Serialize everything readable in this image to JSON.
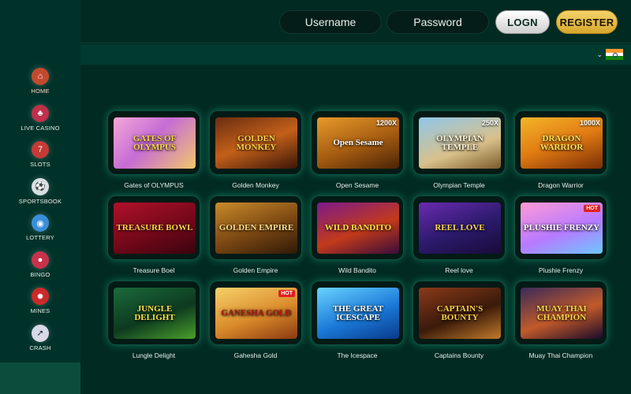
{
  "header": {
    "username_placeholder": "Username",
    "password_placeholder": "Password",
    "login_label": "LOGN",
    "register_label": "REGISTER"
  },
  "language": {
    "icon": "india-flag-icon"
  },
  "sidebar": {
    "items": [
      {
        "label": "HOME",
        "icon": "home-icon",
        "color": "#c24a2e"
      },
      {
        "label": "LIVE CASINO",
        "icon": "live-casino-icon",
        "color": "#c0304a"
      },
      {
        "label": "SLOTS",
        "icon": "slots-icon",
        "color": "#c53a36"
      },
      {
        "label": "SPORTSBOOK",
        "icon": "sportsbook-icon",
        "color": "#d8dfe2"
      },
      {
        "label": "LOTTERY",
        "icon": "lottery-icon",
        "color": "#3a8ed8"
      },
      {
        "label": "BINGO",
        "icon": "bingo-icon",
        "color": "#c8324a"
      },
      {
        "label": "MINES",
        "icon": "mines-icon",
        "color": "#cc2a2a"
      },
      {
        "label": "CRASH",
        "icon": "crash-icon",
        "color": "#d8d8e6"
      }
    ]
  },
  "games": [
    {
      "name": "Gates of OLYMPUS",
      "title": "GATES OF OLYMPUS",
      "bg": "linear-gradient(135deg,#f3a7d8,#c66cd4 45%,#f2c86a)",
      "fg": "#ffd84a"
    },
    {
      "name": "Golden Monkey",
      "title": "GOLDEN MONKEY",
      "bg": "linear-gradient(160deg,#6a2d10,#c3601a 50%,#3b1608)",
      "fg": "#ffd24a"
    },
    {
      "name": "Open Sesame",
      "title": "Open Sesame",
      "bg": "linear-gradient(160deg,#e79a2b,#a35a10 55%,#4a2406)",
      "fg": "#ffffff",
      "badge": "1200X"
    },
    {
      "name": "Olympian Temple",
      "title": "OLYMPIAN TEMPLE",
      "bg": "linear-gradient(160deg,#8fc7ea,#d9c08a 60%,#7a5b2a)",
      "fg": "#fff6d8",
      "badge": "250X"
    },
    {
      "name": "Dragon Warrior",
      "title": "DRAGON WARRIOR",
      "bg": "linear-gradient(160deg,#f4b52a,#e07a12 50%,#7a2d06)",
      "fg": "#ffe35a",
      "badge": "1000X"
    },
    {
      "name": "Treasure Boel",
      "title": "TREASURE BOWL",
      "bg": "linear-gradient(160deg,#b0112a,#6e0718 60%,#3a0410)",
      "fg": "#ffd24a"
    },
    {
      "name": "Golden Empire",
      "title": "GOLDEN EMPIRE",
      "bg": "linear-gradient(160deg,#c98b2a,#7a4612 55%,#2e1a08)",
      "fg": "#ffe08a"
    },
    {
      "name": "Wild Bandito",
      "title": "WILD BANDITO",
      "bg": "linear-gradient(160deg,#7d1a8a,#c23a1a 55%,#3a0c3a)",
      "fg": "#ffe14a"
    },
    {
      "name": "Reel love",
      "title": "REEL LOVE",
      "bg": "linear-gradient(160deg,#6a2ab0,#2a1a6a 55%,#1a0a3a)",
      "fg": "#ffd84a"
    },
    {
      "name": "Plushie Frenzy",
      "title": "PLUSHIE FRENZY",
      "bg": "linear-gradient(160deg,#ff9ad6,#b87aff 55%,#6ac8ff)",
      "fg": "#ffffff",
      "hot": "HOT"
    },
    {
      "name": "Lungle Delight",
      "title": "JUNGLE DELIGHT",
      "bg": "linear-gradient(160deg,#1b6a3a,#0d3a20 55%,#4aa02a)",
      "fg": "#ffe14a"
    },
    {
      "name": "Gahesha Gold",
      "title": "GANESHA GOLD",
      "bg": "linear-gradient(160deg,#f7d26a,#d98a2a 55%,#8a3a10)",
      "fg": "#b01a1a",
      "hot": "HOT"
    },
    {
      "name": "The Icespace",
      "title": "THE GREAT ICESCAPE",
      "bg": "linear-gradient(160deg,#6ad2ff,#1a7ad8 55%,#0a3a8a)",
      "fg": "#ffffff"
    },
    {
      "name": "Captains Bounty",
      "title": "CAPTAIN'S BOUNTY",
      "bg": "linear-gradient(160deg,#8a3a1a,#3a1a0a 55%,#c27a2a)",
      "fg": "#ffd24a"
    },
    {
      "name": "Muay Thai Champion",
      "title": "MUAY THAI CHAMPION",
      "bg": "linear-gradient(160deg,#3a2a5a,#c25a2a 55%,#1a0a2a)",
      "fg": "#ffd84a"
    }
  ]
}
